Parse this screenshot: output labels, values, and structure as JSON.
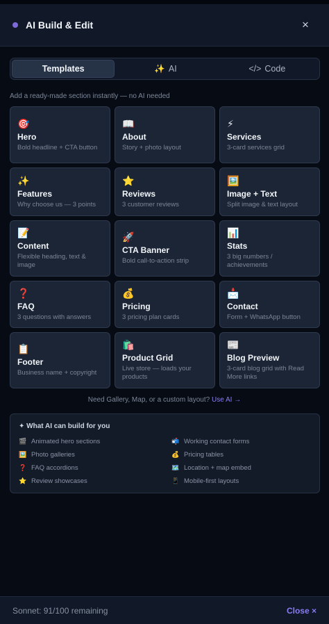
{
  "header": {
    "title": "AI Build & Edit",
    "close_icon": "×"
  },
  "tabs": [
    {
      "label": "Templates",
      "icon": ""
    },
    {
      "label": "AI",
      "icon": "✨"
    },
    {
      "label": "Code",
      "icon": "</>"
    }
  ],
  "hint": "Add a ready-made section instantly — no AI needed",
  "templates": [
    {
      "icon": "🎯",
      "name": "Hero",
      "desc": "Bold headline + CTA button"
    },
    {
      "icon": "📖",
      "name": "About",
      "desc": "Story + photo layout"
    },
    {
      "icon": "⚡",
      "name": "Services",
      "desc": "3-card services grid"
    },
    {
      "icon": "✨",
      "name": "Features",
      "desc": "Why choose us — 3 points"
    },
    {
      "icon": "⭐",
      "name": "Reviews",
      "desc": "3 customer reviews"
    },
    {
      "icon": "🖼️",
      "name": "Image + Text",
      "desc": "Split image & text layout"
    },
    {
      "icon": "📝",
      "name": "Content",
      "desc": "Flexible heading, text & image"
    },
    {
      "icon": "🚀",
      "name": "CTA Banner",
      "desc": "Bold call-to-action strip"
    },
    {
      "icon": "📊",
      "name": "Stats",
      "desc": "3 big numbers / achievements"
    },
    {
      "icon": "❓",
      "name": "FAQ",
      "desc": "3 questions with answers"
    },
    {
      "icon": "💰",
      "name": "Pricing",
      "desc": "3 pricing plan cards"
    },
    {
      "icon": "📩",
      "name": "Contact",
      "desc": "Form + WhatsApp button"
    },
    {
      "icon": "📋",
      "name": "Footer",
      "desc": "Business name + copyright"
    },
    {
      "icon": "🛍️",
      "name": "Product Grid",
      "desc": "Live store — loads your products"
    },
    {
      "icon": "📰",
      "name": "Blog Preview",
      "desc": "3-card blog grid with Read More links"
    }
  ],
  "gallery_note": {
    "text": "Need Gallery, Map, or a custom layout?",
    "link": "Use AI →"
  },
  "ai_box": {
    "title": "✦ What AI can build for you",
    "items": [
      {
        "icon": "🎬",
        "label": "Animated hero sections"
      },
      {
        "icon": "📬",
        "label": "Working contact forms"
      },
      {
        "icon": "🖼️",
        "label": "Photo galleries"
      },
      {
        "icon": "💰",
        "label": "Pricing tables"
      },
      {
        "icon": "❓",
        "label": "FAQ accordions"
      },
      {
        "icon": "🗺️",
        "label": "Location + map embed"
      },
      {
        "icon": "⭐",
        "label": "Review showcases"
      },
      {
        "icon": "📱",
        "label": "Mobile-first layouts"
      }
    ]
  },
  "footer": {
    "quota": "Sonnet: 91/100 remaining",
    "close_label": "Close ×"
  },
  "colors": {
    "background": "#070b14",
    "accent": "#8b7cf6",
    "card": "#1c2535"
  }
}
